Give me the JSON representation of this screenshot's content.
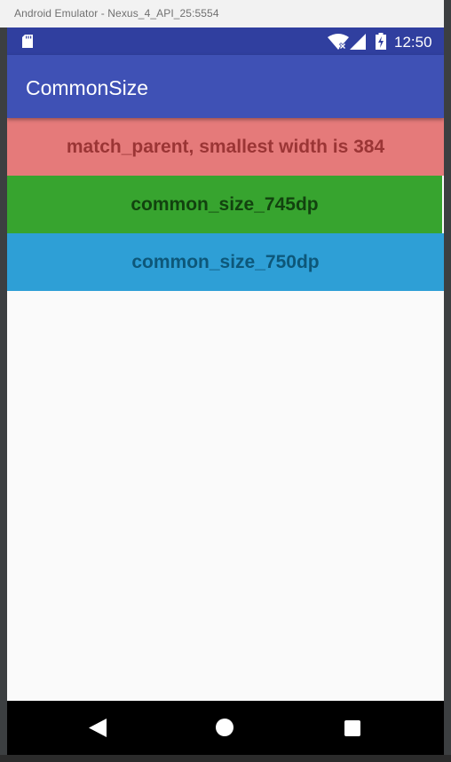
{
  "window": {
    "title": "Android Emulator - Nexus_4_API_25:5554"
  },
  "status_bar": {
    "time": "12:50",
    "icons": [
      "sd-card-icon",
      "wifi-icon",
      "signal-icon",
      "battery-charging-icon"
    ]
  },
  "app_bar": {
    "title": "CommonSize"
  },
  "blocks": [
    {
      "label": "match_parent, smallest width is 384",
      "background": "#e57a7a",
      "text_color": "#9b3535"
    },
    {
      "label": "common_size_745dp",
      "background": "#37a42f",
      "text_color": "#12420f"
    },
    {
      "label": "common_size_750dp",
      "background": "#2e9fd6",
      "text_color": "#0d5779"
    }
  ],
  "nav_bar": {
    "buttons": [
      "back-icon",
      "home-icon",
      "recents-icon"
    ]
  },
  "colors": {
    "status_bar": "#303f9f",
    "app_bar": "#3f51b5",
    "screen_background": "#fafafa",
    "nav_bar": "#000000"
  }
}
